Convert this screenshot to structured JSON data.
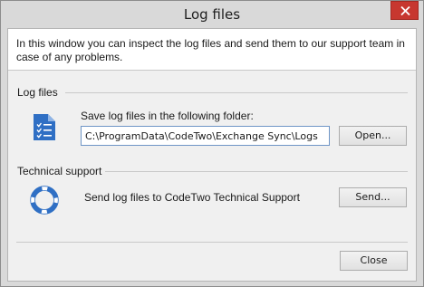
{
  "window": {
    "title": "Log files",
    "close_icon": "close-icon"
  },
  "intro": {
    "text": "In this window you can inspect the log files and send them to our support team in case of any problems."
  },
  "log_files": {
    "group_label": "Log files",
    "icon": "document-checklist-icon",
    "folder_label": "Save log files in the following folder:",
    "folder_path": "C:\\ProgramData\\CodeTwo\\Exchange Sync\\Logs",
    "open_button": "Open..."
  },
  "technical_support": {
    "group_label": "Technical support",
    "icon": "lifebuoy-icon",
    "send_label": "Send log files to CodeTwo Technical Support",
    "send_button": "Send..."
  },
  "footer": {
    "close_button": "Close"
  },
  "colors": {
    "close_button_red": "#c7372f",
    "icon_blue": "#2f6fc4"
  }
}
